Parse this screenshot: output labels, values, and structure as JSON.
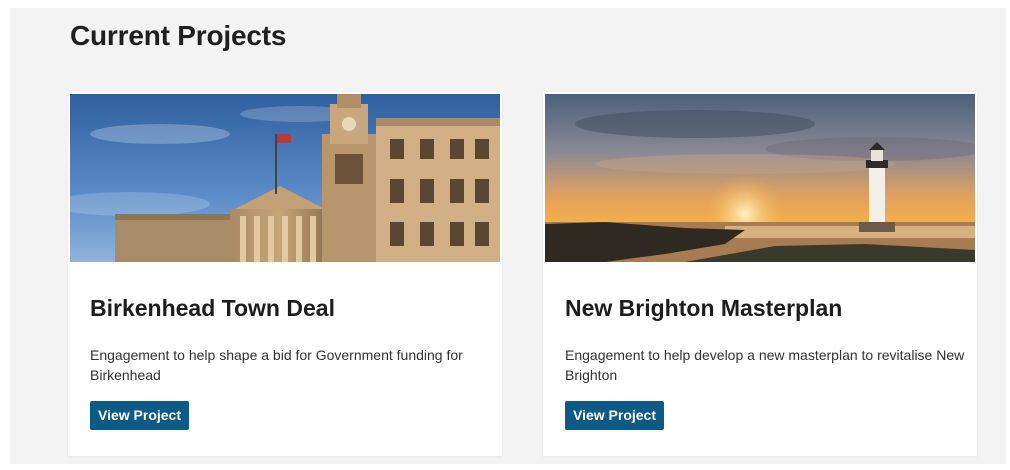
{
  "section": {
    "title": "Current Projects"
  },
  "colors": {
    "button_bg": "#0c5a85",
    "page_bg": "#f3f3f4"
  },
  "projects": [
    {
      "title": "Birkenhead Town Deal",
      "description": "Engagement to help shape a bid for Government funding for Birkenhead",
      "button_label": "View Project",
      "image": "town-hall-photo"
    },
    {
      "title": "New Brighton Masterplan",
      "description": "Engagement to help develop a new masterplan to revitalise New Brighton",
      "button_label": "View Project",
      "image": "lighthouse-sunset-photo"
    }
  ]
}
